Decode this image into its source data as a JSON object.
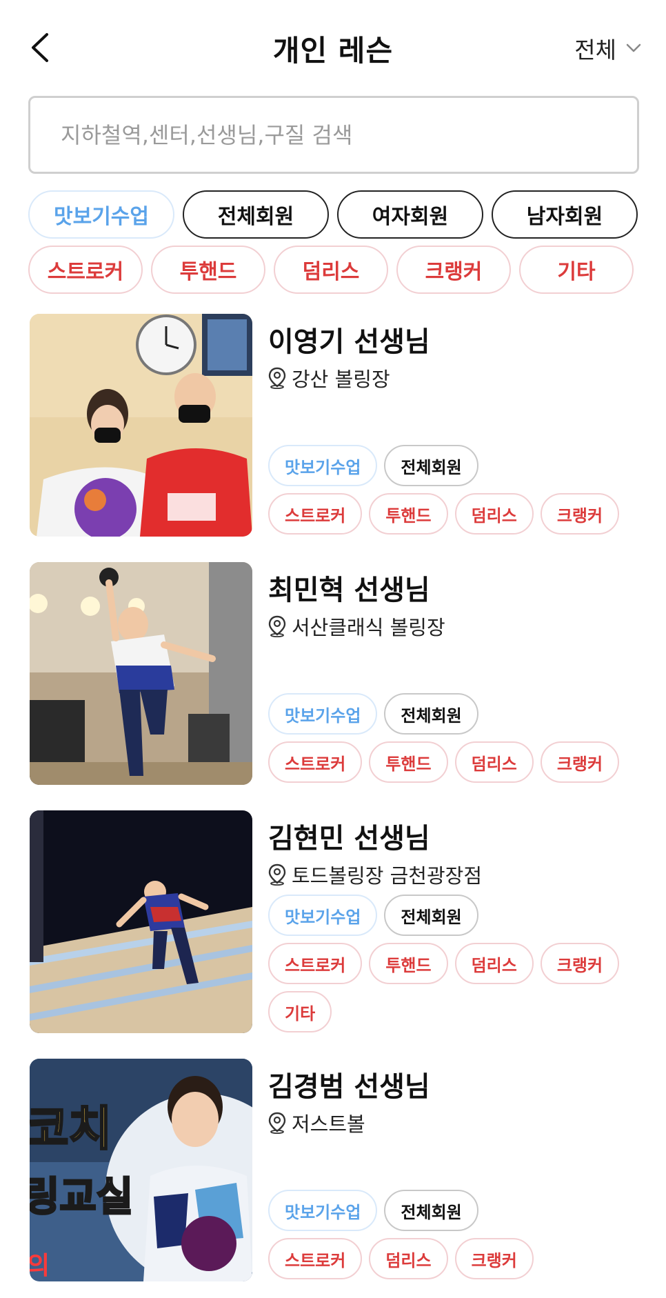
{
  "header": {
    "title": "개인 레슨",
    "filter_label": "전체"
  },
  "search": {
    "placeholder": "지하철역,센터,선생님,구질 검색",
    "value": ""
  },
  "filters": {
    "row1": [
      {
        "label": "맛보기수업",
        "style": "blue"
      },
      {
        "label": "전체회원",
        "style": "black"
      },
      {
        "label": "여자회원",
        "style": "black"
      },
      {
        "label": "남자회원",
        "style": "black"
      }
    ],
    "row2": [
      {
        "label": "스트로커",
        "style": "red"
      },
      {
        "label": "투핸드",
        "style": "red"
      },
      {
        "label": "덤리스",
        "style": "red"
      },
      {
        "label": "크랭커",
        "style": "red"
      },
      {
        "label": "기타",
        "style": "red"
      }
    ]
  },
  "teachers": [
    {
      "name": "이영기 선생님",
      "location": "강산 볼링장",
      "class_tags": [
        "맛보기수업",
        "전체회원"
      ],
      "style_tags": [
        "스트로커",
        "투핸드",
        "덤리스",
        "크랭커"
      ]
    },
    {
      "name": "최민혁 선생님",
      "location": "서산클래식 볼링장",
      "class_tags": [
        "맛보기수업",
        "전체회원"
      ],
      "style_tags": [
        "스트로커",
        "투핸드",
        "덤리스",
        "크랭커"
      ]
    },
    {
      "name": "김현민 선생님",
      "location": "토드볼링장 금천광장점",
      "class_tags": [
        "맛보기수업",
        "전체회원"
      ],
      "style_tags": [
        "스트로커",
        "투핸드",
        "덤리스",
        "크랭커",
        "기타"
      ]
    },
    {
      "name": "김경범 선생님",
      "location": "저스트볼",
      "photo_text": [
        "코치",
        "링교실",
        "의"
      ],
      "class_tags": [
        "맛보기수업",
        "전체회원"
      ],
      "style_tags": [
        "스트로커",
        "덤리스",
        "크랭커"
      ]
    }
  ],
  "colors": {
    "blue_chip_text": "#5aa3ea",
    "red_chip_text": "#dc3b3b",
    "red_chip_border": "#f2cfd2",
    "blue_chip_border": "#d9e9fa"
  }
}
